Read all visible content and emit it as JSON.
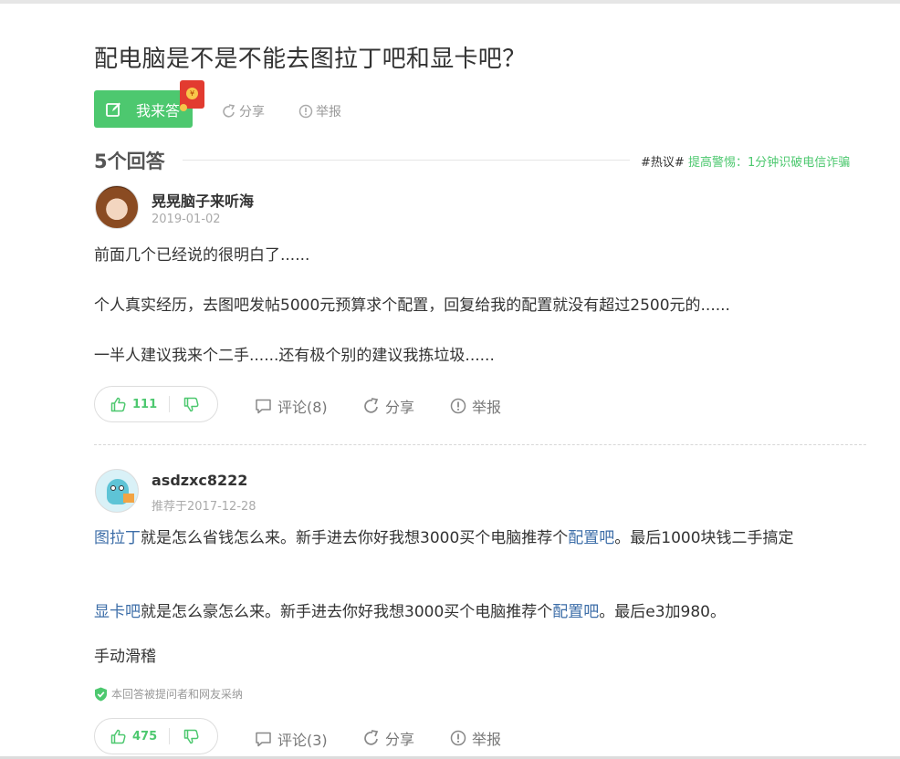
{
  "question": {
    "title": "配电脑是不是不能去图拉丁吧和显卡吧？",
    "answer_button": "我来答",
    "share": "分享",
    "report": "举报"
  },
  "answers_header": {
    "count_label": "5个回答",
    "hot_tag": "#热议#",
    "hot_link": "提高警惕：1分钟识破电信诈骗"
  },
  "answers": [
    {
      "username": "晃晃脑子来听海",
      "date": "2019-01-02",
      "paragraphs": [
        "前面几个已经说的很明白了......",
        "个人真实经历，去图吧发帖5000元预算求个配置，回复给我的配置就没有超过2500元的......",
        "一半人建议我来个二手......还有极个别的建议我拣垃圾......"
      ],
      "likes": "111",
      "comments": "评论(8)",
      "share": "分享",
      "report": "举报"
    },
    {
      "username": "asdzxc8222",
      "date": "推荐于2017-12-28",
      "p1": {
        "link1": "图拉丁",
        "text1": "就是怎么省钱怎么来。新手进去你好我想3000买个电脑推荐个",
        "link2": "配置吧",
        "text2": "。最后1000块钱二手搞定"
      },
      "p2": {
        "link1": "显卡吧",
        "text1": "就是怎么豪怎么来。新手进去你好我想3000买个电脑推荐个",
        "link2": "配置吧",
        "text2": "。最后e3加980。"
      },
      "p3": "手动滑稽",
      "adopted": "本回答被提问者和网友采纳",
      "likes": "475",
      "comments": "评论(3)",
      "share": "分享",
      "report": "举报"
    }
  ],
  "colors": {
    "accent_green": "#4dc86f",
    "link_blue": "#3d6ea8",
    "text": "#333333",
    "muted": "#999999"
  }
}
